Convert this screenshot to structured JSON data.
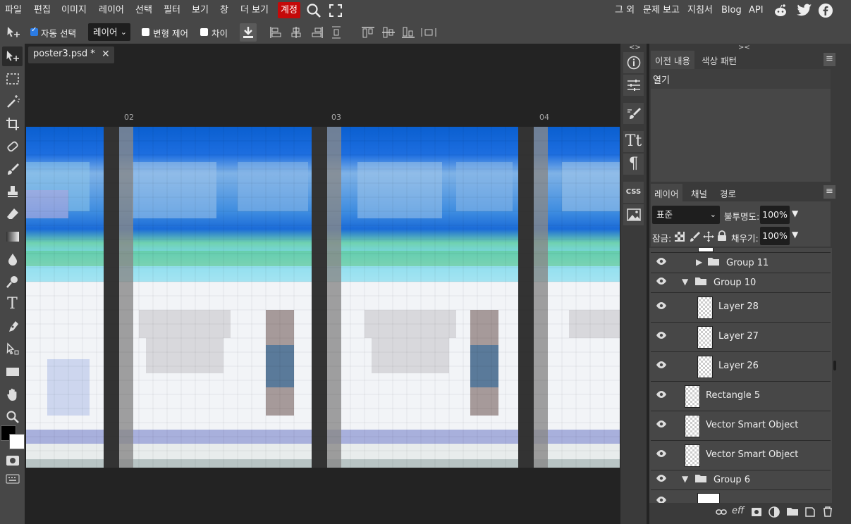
{
  "menu": {
    "items": [
      "파일",
      "편집",
      "이미지",
      "레이어",
      "선택",
      "필터",
      "보기",
      "창",
      "더 보기"
    ],
    "account": "계정",
    "right_items": [
      "그 외",
      "문제 보고",
      "지침서",
      "Blog",
      "API"
    ]
  },
  "options": {
    "auto_select_label": "자동 선택",
    "auto_select_checked": true,
    "layer_select_value": "레이어",
    "transform_label": "변형 제어",
    "distance_label": "차이"
  },
  "document": {
    "tab_title": "poster3.psd *",
    "ruler_labels": [
      "02",
      "03",
      "04"
    ]
  },
  "history_panel": {
    "tabs": [
      "이전 내용",
      "색상 패턴"
    ],
    "items": [
      "열기"
    ]
  },
  "layers_panel": {
    "tabs": [
      "레이어",
      "채널",
      "경로"
    ],
    "blend_mode": "표준",
    "opacity_label": "불투명도:",
    "opacity_value": "100%",
    "lock_label": "잠금:",
    "fill_label": "채우기:",
    "fill_value": "100%",
    "layers": [
      {
        "name": "Group 11",
        "type": "group",
        "indent": 1,
        "expanded": false
      },
      {
        "name": "Group 10",
        "type": "group",
        "indent": 0,
        "expanded": true
      },
      {
        "name": "Layer 28",
        "type": "layer",
        "indent": 2
      },
      {
        "name": "Layer 27",
        "type": "layer",
        "indent": 2
      },
      {
        "name": "Layer 26",
        "type": "layer",
        "indent": 2
      },
      {
        "name": "Rectangle 5",
        "type": "layer",
        "indent": 1
      },
      {
        "name": "Vector Smart Object",
        "type": "layer",
        "indent": 1
      },
      {
        "name": "Vector Smart Object",
        "type": "layer",
        "indent": 1
      },
      {
        "name": "Group 6",
        "type": "group",
        "indent": 0,
        "expanded": true
      }
    ]
  },
  "colors": {
    "accent": "#2b7be3",
    "account_badge": "#c40a0a",
    "panel_bg": "#474747"
  }
}
